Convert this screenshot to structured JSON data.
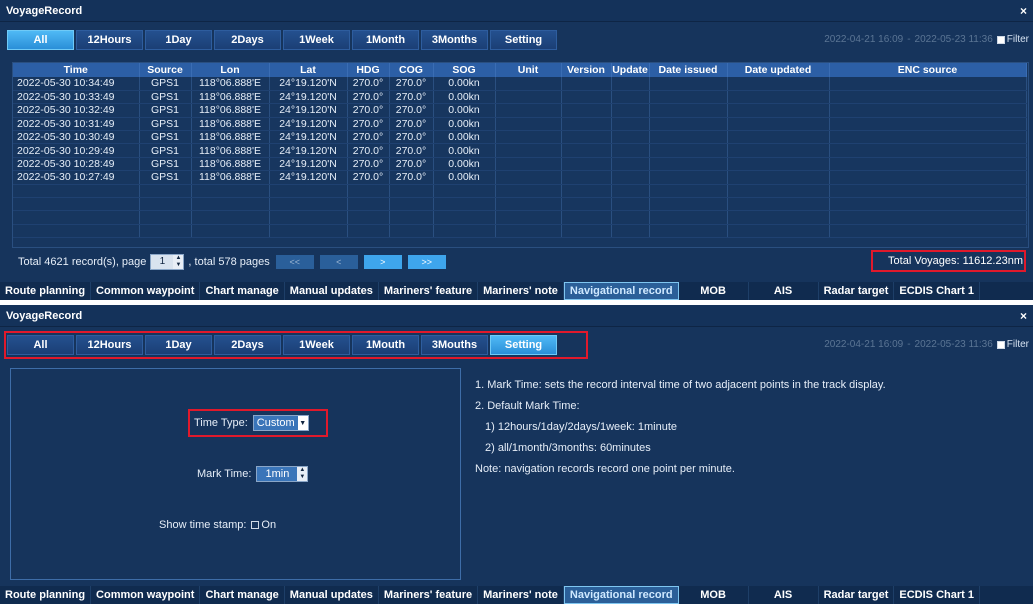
{
  "window_title": "VoyageRecord",
  "close_glyph": "×",
  "tabs_top": [
    "All",
    "12Hours",
    "1Day",
    "2Days",
    "1Week",
    "1Month",
    "3Months",
    "Setting"
  ],
  "tabs_bottom": [
    "All",
    "12Hours",
    "1Day",
    "2Days",
    "1Week",
    "1Mouth",
    "3Mouths",
    "Setting"
  ],
  "date_range": {
    "start": "2022-04-21 16:09",
    "sep": "-",
    "end": "2022-05-23 11:36",
    "filter_label": "Filter"
  },
  "table": {
    "columns": [
      "Time",
      "Source",
      "Lon",
      "Lat",
      "HDG",
      "COG",
      "SOG",
      "Unit",
      "Version",
      "Update",
      "Date issued",
      "Date updated",
      "ENC source"
    ],
    "rows": [
      [
        "2022-05-30 10:34:49",
        "GPS1",
        "118°06.888'E",
        "24°19.120'N",
        "270.0°",
        "270.0°",
        "0.00kn"
      ],
      [
        "2022-05-30 10:33:49",
        "GPS1",
        "118°06.888'E",
        "24°19.120'N",
        "270.0°",
        "270.0°",
        "0.00kn"
      ],
      [
        "2022-05-30 10:32:49",
        "GPS1",
        "118°06.888'E",
        "24°19.120'N",
        "270.0°",
        "270.0°",
        "0.00kn"
      ],
      [
        "2022-05-30 10:31:49",
        "GPS1",
        "118°06.888'E",
        "24°19.120'N",
        "270.0°",
        "270.0°",
        "0.00kn"
      ],
      [
        "2022-05-30 10:30:49",
        "GPS1",
        "118°06.888'E",
        "24°19.120'N",
        "270.0°",
        "270.0°",
        "0.00kn"
      ],
      [
        "2022-05-30 10:29:49",
        "GPS1",
        "118°06.888'E",
        "24°19.120'N",
        "270.0°",
        "270.0°",
        "0.00kn"
      ],
      [
        "2022-05-30 10:28:49",
        "GPS1",
        "118°06.888'E",
        "24°19.120'N",
        "270.0°",
        "270.0°",
        "0.00kn"
      ],
      [
        "2022-05-30 10:27:49",
        "GPS1",
        "118°06.888'E",
        "24°19.120'N",
        "270.0°",
        "270.0°",
        "0.00kn"
      ]
    ]
  },
  "pager": {
    "prefix": "Total 4621 record(s), page",
    "page": "1",
    "suffix": ", total 578 pages",
    "buttons": [
      "<<",
      "<",
      ">",
      ">>"
    ]
  },
  "total_voyages": "Total Voyages: 11612.23nm",
  "bottom_nav": [
    "Route planning",
    "Common waypoint",
    "Chart manage",
    "Manual updates",
    "Mariners' feature",
    "Mariners' note",
    "Navigational record",
    "MOB",
    "AIS",
    "Radar target",
    "ECDIS Chart 1"
  ],
  "settings": {
    "time_type_label": "Time Type:",
    "time_type_value": "Custom",
    "mark_time_label": "Mark Time:",
    "mark_time_value": "1min",
    "show_stamp_label": "Show time stamp:",
    "show_stamp_value": "On"
  },
  "help": {
    "l1": "1. Mark Time: sets the record interval time of two adjacent points in the track display.",
    "l2": "2. Default Mark Time:",
    "l3": "1) 12hours/1day/2days/1week: 1minute",
    "l4": "2) all/1month/3months: 60minutes",
    "l5": "Note: navigation records record one point per minute."
  },
  "colors": {
    "accent": "#3ea5ec",
    "panel": "#16345c",
    "highlight": "#e0192b"
  }
}
